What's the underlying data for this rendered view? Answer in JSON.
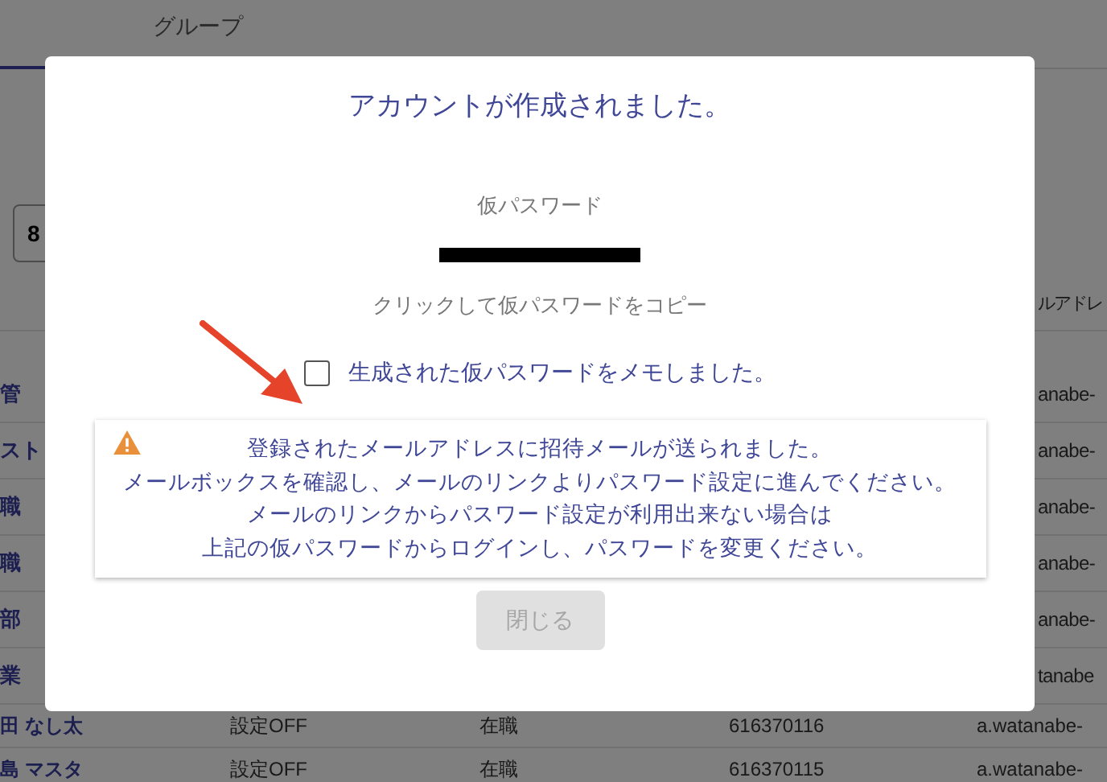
{
  "background": {
    "tabs": [
      {
        "label": "グループ",
        "selected": false
      }
    ],
    "search": {
      "value": "8"
    },
    "table": {
      "header": {
        "email": "ルアドレ"
      },
      "rows": [
        {
          "name": "管",
          "email": "anabe-"
        },
        {
          "name": "スト",
          "email": "anabe-"
        },
        {
          "name": "職",
          "email": "anabe-"
        },
        {
          "name": "職",
          "email": "anabe-"
        },
        {
          "name": "部",
          "email": "anabe-"
        },
        {
          "name": "業",
          "email": "tanabe"
        },
        {
          "name": "田 なし太",
          "setting": "設定OFF",
          "status": "在職",
          "number": "616370116",
          "email": "a.watanabe-"
        },
        {
          "name": "島 マスタ",
          "setting": "設定OFF",
          "status": "在職",
          "number": "616370115",
          "email": "a.watanabe-"
        }
      ]
    }
  },
  "dialog": {
    "title": "アカウントが作成されました。",
    "password_label": "仮パスワード",
    "password_redacted": true,
    "copy_hint": "クリックして仮パスワードをコピー",
    "confirm": {
      "label": "生成された仮パスワードをメモしました。",
      "checked": false
    },
    "notice": {
      "lines": [
        "登録されたメールアドレスに招待メールが送られました。",
        "メールボックスを確認し、メールのリンクよりパスワード設定に進んでください。",
        "メールのリンクからパスワード設定が利用出来ない場合は",
        "上記の仮パスワードからログインし、パスワードを変更ください。"
      ]
    },
    "close_button": {
      "label": "閉じる",
      "disabled": true
    }
  }
}
